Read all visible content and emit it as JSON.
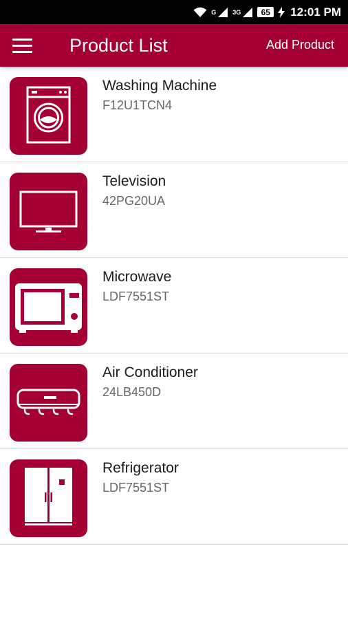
{
  "status_bar": {
    "network_label_1": "G",
    "network_label_2": "3G",
    "battery": "65",
    "time": "12:01 PM"
  },
  "app_bar": {
    "title": "Product List",
    "action_label": "Add Product"
  },
  "colors": {
    "brand": "#a50034",
    "divider": "#d7d7d7",
    "text_primary": "#1a1a1a",
    "text_secondary": "#666666"
  },
  "products": [
    {
      "name": "Washing Machine",
      "model": "F12U1TCN4",
      "icon": "washing-machine-icon"
    },
    {
      "name": "Television",
      "model": "42PG20UA",
      "icon": "television-icon"
    },
    {
      "name": "Microwave",
      "model": "LDF7551ST",
      "icon": "microwave-icon"
    },
    {
      "name": "Air Conditioner",
      "model": "24LB450D",
      "icon": "air-conditioner-icon"
    },
    {
      "name": "Refrigerator",
      "model": "LDF7551ST",
      "icon": "refrigerator-icon"
    }
  ]
}
